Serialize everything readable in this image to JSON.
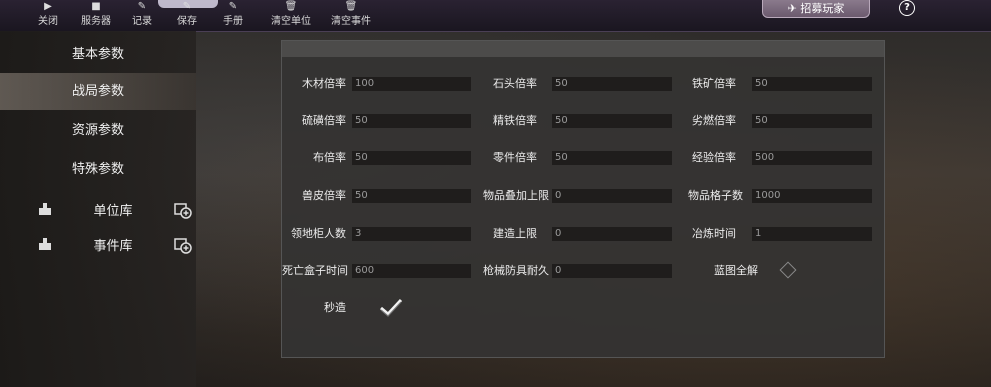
{
  "toolbar": {
    "items": [
      {
        "label": "关闭",
        "icon": "play-icon"
      },
      {
        "label": "服务器",
        "icon": "cube-icon"
      },
      {
        "label": "记录",
        "icon": "edit-icon"
      },
      {
        "label": "保存",
        "icon": "edit-icon"
      },
      {
        "label": "手册",
        "icon": "edit-icon"
      },
      {
        "label": "清空单位",
        "icon": "trash-icon"
      },
      {
        "label": "清空事件",
        "icon": "trash-icon"
      }
    ],
    "recruit_label": "招募玩家",
    "help_label": "?"
  },
  "sidebar": {
    "items": [
      {
        "label": "基本参数",
        "active": false
      },
      {
        "label": "战局参数",
        "active": true
      },
      {
        "label": "资源参数",
        "active": false
      },
      {
        "label": "特殊参数",
        "active": false
      }
    ],
    "libraries": [
      {
        "label": "单位库"
      },
      {
        "label": "事件库"
      }
    ]
  },
  "form": {
    "rows": [
      [
        {
          "label": "木材倍率",
          "value": "100"
        },
        {
          "label": "石头倍率",
          "value": "50"
        },
        {
          "label": "铁矿倍率",
          "value": "50"
        }
      ],
      [
        {
          "label": "硫磺倍率",
          "value": "50"
        },
        {
          "label": "精铁倍率",
          "value": "50"
        },
        {
          "label": "劣燃倍率",
          "value": "50"
        }
      ],
      [
        {
          "label": "布倍率",
          "value": "50"
        },
        {
          "label": "零件倍率",
          "value": "50"
        },
        {
          "label": "经验倍率",
          "value": "500"
        }
      ],
      [
        {
          "label": "兽皮倍率",
          "value": "50"
        },
        {
          "label": "物品叠加上限",
          "value": "0"
        },
        {
          "label": "物品格子数",
          "value": "1000"
        }
      ],
      [
        {
          "label": "领地柜人数",
          "value": "3"
        },
        {
          "label": "建造上限",
          "value": "0"
        },
        {
          "label": "冶炼时间",
          "value": "1"
        }
      ],
      [
        {
          "label": "死亡盒子时间",
          "value": "600"
        },
        {
          "label": "枪械防具耐久",
          "value": "0"
        }
      ]
    ],
    "blueprint_label": "蓝图全解",
    "blueprint_checked": false,
    "instant_build_label": "秒造",
    "instant_build_checked": true
  },
  "colors": {
    "panel": "#343332",
    "input": "#1f1d1c",
    "active_tab": "#8c8278"
  }
}
